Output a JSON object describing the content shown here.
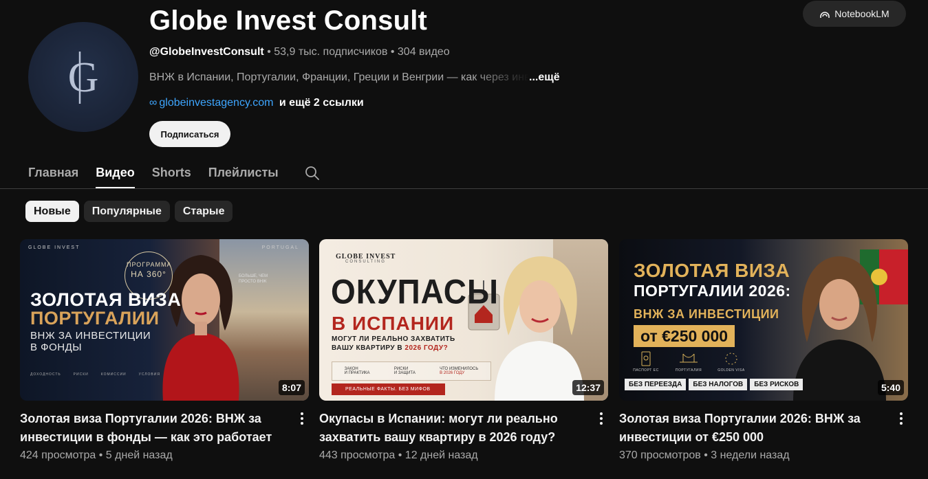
{
  "channel": {
    "name": "Globe Invest Consult",
    "handle": "@GlobeInvestConsult",
    "subscribers": "53,9 тыс. подписчиков",
    "video_count": "304 видео",
    "separator": "•",
    "description": "ВНЖ в Испании, Португалии, Франции, Греции и Венгрии — как через инвестиции",
    "description_more": "...ещё",
    "link_icon": "∞",
    "link_url": "globeinvestagency.com",
    "more_links": "и ещё 2 ссылки",
    "subscribe_label": "Подписаться",
    "avatar_icon": "globe-invest-monogram-icon"
  },
  "notebook": {
    "label": "NotebookLM"
  },
  "tabs": [
    {
      "label": "Главная",
      "active": false
    },
    {
      "label": "Видео",
      "active": true
    },
    {
      "label": "Shorts",
      "active": false
    },
    {
      "label": "Плейлисты",
      "active": false
    }
  ],
  "chips": [
    {
      "label": "Новые",
      "active": true
    },
    {
      "label": "Популярные",
      "active": false
    },
    {
      "label": "Старые",
      "active": false
    }
  ],
  "videos": [
    {
      "title": "Золотая виза Португалии 2026: ВНЖ за инвестиции в фонды — как это работает",
      "views": "424 просмотра",
      "age": "5 дней назад",
      "duration": "8:07",
      "thumb": {
        "brand": "GLOBE INVEST",
        "region": "PORTUGAL",
        "badge_line1": "ПРОГРАММА",
        "badge_line2": "НА 360°",
        "line1": "ЗОЛОТАЯ ВИЗА",
        "line2": "ПОРТУГАЛИИ",
        "line3": "ВНЖ ЗА ИНВЕСТИЦИИ",
        "line4": "В ФОНДЫ",
        "side_note": "БОЛЬШЕ, ЧЕМ ПРОСТО ВНЖ",
        "footnotes": [
          "ДОХОДНОСТЬ",
          "РИСКИ",
          "КОМИССИИ",
          "УСЛОВИЯ"
        ]
      }
    },
    {
      "title": "Окупасы в Испании: могут ли реально захватить вашу квартиру в 2026 году?",
      "views": "443 просмотра",
      "age": "12 дней назад",
      "duration": "12:37",
      "thumb": {
        "brand": "GLOBE INVEST",
        "brand_sub": "CONSULTING",
        "line1": "ОКУПАСЫ",
        "line2": "В ИСПАНИИ",
        "line3": "МОГУТ ЛИ РЕАЛЬНО ЗАХВАТИТЬ",
        "line4": "ВАШУ КВАРТИРУ В",
        "line4_year": "2026 ГОДУ?",
        "info": [
          {
            "top": "ЗАКОН",
            "bottom": "И ПРАКТИКА"
          },
          {
            "top": "РИСКИ",
            "bottom": "И ЗАЩИТА"
          },
          {
            "top": "ЧТО ИЗМЕНИЛОСЬ",
            "bottom": "В 2026 ГОДУ"
          }
        ],
        "banner": "РЕАЛЬНЫЕ ФАКТЫ. БЕЗ МИФОВ"
      }
    },
    {
      "title": "Золотая виза Португалии 2026: ВНЖ за инвестиции от €250 000",
      "views": "370 просмотров",
      "age": "3 недели назад",
      "duration": "5:40",
      "thumb": {
        "line1": "ЗОЛОТАЯ ВИЗА",
        "line2": "ПОРТУГАЛИИ 2026:",
        "line3": "ВНЖ ЗА ИНВЕСТИЦИИ",
        "price": "от €250 000",
        "icons": [
          "ПАСПОРТ ЕС",
          "ПОРТУГАЛИЯ",
          "GOLDEN VISA"
        ],
        "footer": [
          "БЕЗ ПЕРЕЕЗДА",
          "БЕЗ НАЛОГОВ",
          "БЕЗ РИСКОВ"
        ]
      }
    }
  ],
  "colors": {
    "background": "#0f0f0f",
    "link": "#3ea6ff",
    "chip_active_bg": "#f1f1f1",
    "chip_bg": "#272727",
    "accent_gold": "#e2b25a",
    "accent_red": "#b3261e"
  }
}
